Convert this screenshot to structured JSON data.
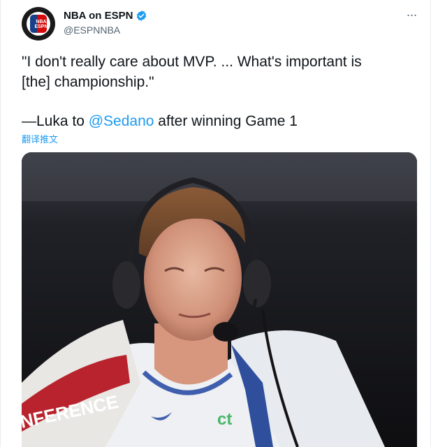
{
  "tweet": {
    "display_name": "NBA on ESPN",
    "handle": "@ESPNNBA",
    "avatar_text": "NBA ESPN",
    "more_label": "···",
    "line1": "\"I don't really care about MVP. ... What's important is",
    "line2": "[the] championship.\"",
    "line3_prefix": "—Luka to ",
    "mention": "@Sedano",
    "line3_suffix": " after winning Game 1",
    "translate_label": "翻译推文"
  },
  "media": {
    "towel_text": "NFERENCE",
    "jersey_logo": "ct"
  },
  "colors": {
    "link": "#1d9bf0",
    "text": "#0f1419",
    "secondary": "#536471",
    "verified": "#1d9bf0"
  }
}
